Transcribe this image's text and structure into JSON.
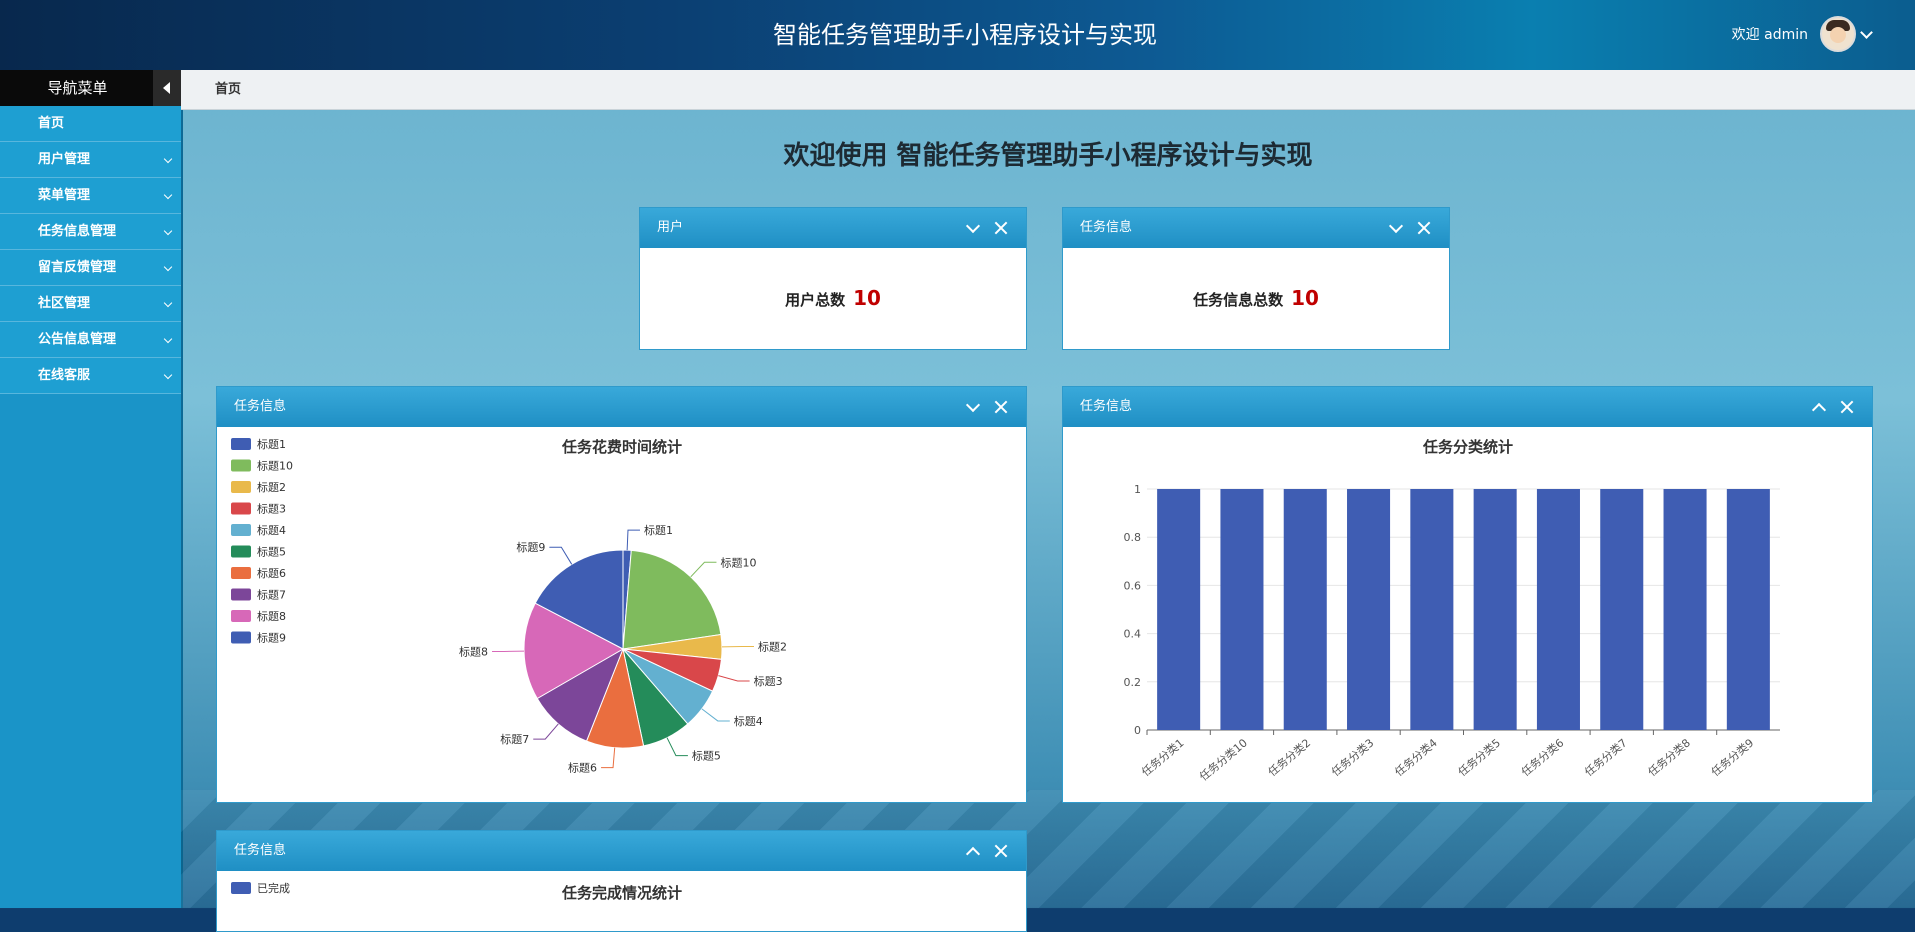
{
  "header": {
    "title": "智能任务管理助手小程序设计与实现",
    "greeting": "欢迎 admin",
    "avatar_icon": "user-avatar"
  },
  "sidebar": {
    "title": "导航菜单",
    "items": [
      {
        "label": "首页",
        "expandable": false
      },
      {
        "label": "用户管理",
        "expandable": true
      },
      {
        "label": "菜单管理",
        "expandable": true
      },
      {
        "label": "任务信息管理",
        "expandable": true
      },
      {
        "label": "留言反馈管理",
        "expandable": true
      },
      {
        "label": "社区管理",
        "expandable": true
      },
      {
        "label": "公告信息管理",
        "expandable": true
      },
      {
        "label": "在线客服",
        "expandable": true
      }
    ]
  },
  "breadcrumb": "首页",
  "welcome": "欢迎使用 智能任务管理助手小程序设计与实现",
  "stats": [
    {
      "panel_title": "用户",
      "label": "用户总数",
      "value": "10"
    },
    {
      "panel_title": "任务信息",
      "label": "任务信息总数",
      "value": "10"
    }
  ],
  "charts": {
    "pie_panel_title": "任务信息",
    "bar_panel_title": "任务信息",
    "done_panel_title": "任务信息"
  },
  "colors": {
    "accent": "#1f8fc4",
    "highlight": "#c00000"
  },
  "chart_data": [
    {
      "type": "pie",
      "title": "任务花费时间统计",
      "legend": "top-left",
      "categories": [
        "标题1",
        "标题10",
        "标题2",
        "标题3",
        "标题4",
        "标题5",
        "标题6",
        "标题7",
        "标题8",
        "标题9"
      ],
      "values": [
        1,
        16,
        3,
        4,
        5,
        6,
        7,
        8,
        12,
        13
      ],
      "colors": [
        "#3f5db3",
        "#7fbb5d",
        "#e9b94b",
        "#d9474a",
        "#63b0d0",
        "#248c5a",
        "#ea6e3f",
        "#7c4699",
        "#d768b8",
        "#3f5db3"
      ]
    },
    {
      "type": "bar",
      "title": "任务分类统计",
      "categories": [
        "任务分类1",
        "任务分类10",
        "任务分类2",
        "任务分类3",
        "任务分类4",
        "任务分类5",
        "任务分类6",
        "任务分类7",
        "任务分类8",
        "任务分类9"
      ],
      "values": [
        1,
        1,
        1,
        1,
        1,
        1,
        1,
        1,
        1,
        1
      ],
      "ylim": [
        0,
        1
      ],
      "yticks": [
        "0",
        "0.2",
        "0.4",
        "0.6",
        "0.8",
        "1"
      ],
      "grid": true,
      "color": "#3f5db3"
    },
    {
      "type": "pie",
      "title": "任务完成情况统计",
      "legend": "top-left",
      "categories": [
        "已完成"
      ],
      "colors": [
        "#3f5db3"
      ]
    }
  ]
}
